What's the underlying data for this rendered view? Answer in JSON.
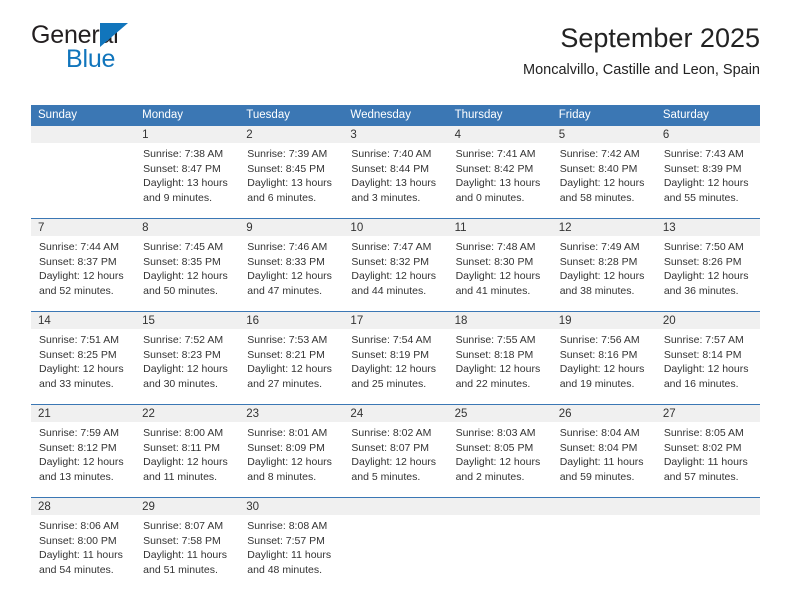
{
  "brand": {
    "name_part1": "General",
    "name_part2": "Blue",
    "triangle_color": "#1175bc",
    "text_color": "#231f20"
  },
  "header": {
    "title": "September 2025",
    "subtitle": "Moncalvillo, Castille and Leon, Spain"
  },
  "theme": {
    "header_blue": "#3b77b4",
    "daynum_band": "#f0f0f0",
    "text": "#333333"
  },
  "weekday_headers": [
    "Sunday",
    "Monday",
    "Tuesday",
    "Wednesday",
    "Thursday",
    "Friday",
    "Saturday"
  ],
  "weeks": [
    {
      "days": [
        {
          "num": "",
          "sunrise": "",
          "sunset": "",
          "daylight_1": "",
          "daylight_2": ""
        },
        {
          "num": "1",
          "sunrise": "Sunrise: 7:38 AM",
          "sunset": "Sunset: 8:47 PM",
          "daylight_1": "Daylight: 13 hours",
          "daylight_2": "and 9 minutes."
        },
        {
          "num": "2",
          "sunrise": "Sunrise: 7:39 AM",
          "sunset": "Sunset: 8:45 PM",
          "daylight_1": "Daylight: 13 hours",
          "daylight_2": "and 6 minutes."
        },
        {
          "num": "3",
          "sunrise": "Sunrise: 7:40 AM",
          "sunset": "Sunset: 8:44 PM",
          "daylight_1": "Daylight: 13 hours",
          "daylight_2": "and 3 minutes."
        },
        {
          "num": "4",
          "sunrise": "Sunrise: 7:41 AM",
          "sunset": "Sunset: 8:42 PM",
          "daylight_1": "Daylight: 13 hours",
          "daylight_2": "and 0 minutes."
        },
        {
          "num": "5",
          "sunrise": "Sunrise: 7:42 AM",
          "sunset": "Sunset: 8:40 PM",
          "daylight_1": "Daylight: 12 hours",
          "daylight_2": "and 58 minutes."
        },
        {
          "num": "6",
          "sunrise": "Sunrise: 7:43 AM",
          "sunset": "Sunset: 8:39 PM",
          "daylight_1": "Daylight: 12 hours",
          "daylight_2": "and 55 minutes."
        }
      ]
    },
    {
      "days": [
        {
          "num": "7",
          "sunrise": "Sunrise: 7:44 AM",
          "sunset": "Sunset: 8:37 PM",
          "daylight_1": "Daylight: 12 hours",
          "daylight_2": "and 52 minutes."
        },
        {
          "num": "8",
          "sunrise": "Sunrise: 7:45 AM",
          "sunset": "Sunset: 8:35 PM",
          "daylight_1": "Daylight: 12 hours",
          "daylight_2": "and 50 minutes."
        },
        {
          "num": "9",
          "sunrise": "Sunrise: 7:46 AM",
          "sunset": "Sunset: 8:33 PM",
          "daylight_1": "Daylight: 12 hours",
          "daylight_2": "and 47 minutes."
        },
        {
          "num": "10",
          "sunrise": "Sunrise: 7:47 AM",
          "sunset": "Sunset: 8:32 PM",
          "daylight_1": "Daylight: 12 hours",
          "daylight_2": "and 44 minutes."
        },
        {
          "num": "11",
          "sunrise": "Sunrise: 7:48 AM",
          "sunset": "Sunset: 8:30 PM",
          "daylight_1": "Daylight: 12 hours",
          "daylight_2": "and 41 minutes."
        },
        {
          "num": "12",
          "sunrise": "Sunrise: 7:49 AM",
          "sunset": "Sunset: 8:28 PM",
          "daylight_1": "Daylight: 12 hours",
          "daylight_2": "and 38 minutes."
        },
        {
          "num": "13",
          "sunrise": "Sunrise: 7:50 AM",
          "sunset": "Sunset: 8:26 PM",
          "daylight_1": "Daylight: 12 hours",
          "daylight_2": "and 36 minutes."
        }
      ]
    },
    {
      "days": [
        {
          "num": "14",
          "sunrise": "Sunrise: 7:51 AM",
          "sunset": "Sunset: 8:25 PM",
          "daylight_1": "Daylight: 12 hours",
          "daylight_2": "and 33 minutes."
        },
        {
          "num": "15",
          "sunrise": "Sunrise: 7:52 AM",
          "sunset": "Sunset: 8:23 PM",
          "daylight_1": "Daylight: 12 hours",
          "daylight_2": "and 30 minutes."
        },
        {
          "num": "16",
          "sunrise": "Sunrise: 7:53 AM",
          "sunset": "Sunset: 8:21 PM",
          "daylight_1": "Daylight: 12 hours",
          "daylight_2": "and 27 minutes."
        },
        {
          "num": "17",
          "sunrise": "Sunrise: 7:54 AM",
          "sunset": "Sunset: 8:19 PM",
          "daylight_1": "Daylight: 12 hours",
          "daylight_2": "and 25 minutes."
        },
        {
          "num": "18",
          "sunrise": "Sunrise: 7:55 AM",
          "sunset": "Sunset: 8:18 PM",
          "daylight_1": "Daylight: 12 hours",
          "daylight_2": "and 22 minutes."
        },
        {
          "num": "19",
          "sunrise": "Sunrise: 7:56 AM",
          "sunset": "Sunset: 8:16 PM",
          "daylight_1": "Daylight: 12 hours",
          "daylight_2": "and 19 minutes."
        },
        {
          "num": "20",
          "sunrise": "Sunrise: 7:57 AM",
          "sunset": "Sunset: 8:14 PM",
          "daylight_1": "Daylight: 12 hours",
          "daylight_2": "and 16 minutes."
        }
      ]
    },
    {
      "days": [
        {
          "num": "21",
          "sunrise": "Sunrise: 7:59 AM",
          "sunset": "Sunset: 8:12 PM",
          "daylight_1": "Daylight: 12 hours",
          "daylight_2": "and 13 minutes."
        },
        {
          "num": "22",
          "sunrise": "Sunrise: 8:00 AM",
          "sunset": "Sunset: 8:11 PM",
          "daylight_1": "Daylight: 12 hours",
          "daylight_2": "and 11 minutes."
        },
        {
          "num": "23",
          "sunrise": "Sunrise: 8:01 AM",
          "sunset": "Sunset: 8:09 PM",
          "daylight_1": "Daylight: 12 hours",
          "daylight_2": "and 8 minutes."
        },
        {
          "num": "24",
          "sunrise": "Sunrise: 8:02 AM",
          "sunset": "Sunset: 8:07 PM",
          "daylight_1": "Daylight: 12 hours",
          "daylight_2": "and 5 minutes."
        },
        {
          "num": "25",
          "sunrise": "Sunrise: 8:03 AM",
          "sunset": "Sunset: 8:05 PM",
          "daylight_1": "Daylight: 12 hours",
          "daylight_2": "and 2 minutes."
        },
        {
          "num": "26",
          "sunrise": "Sunrise: 8:04 AM",
          "sunset": "Sunset: 8:04 PM",
          "daylight_1": "Daylight: 11 hours",
          "daylight_2": "and 59 minutes."
        },
        {
          "num": "27",
          "sunrise": "Sunrise: 8:05 AM",
          "sunset": "Sunset: 8:02 PM",
          "daylight_1": "Daylight: 11 hours",
          "daylight_2": "and 57 minutes."
        }
      ]
    },
    {
      "days": [
        {
          "num": "28",
          "sunrise": "Sunrise: 8:06 AM",
          "sunset": "Sunset: 8:00 PM",
          "daylight_1": "Daylight: 11 hours",
          "daylight_2": "and 54 minutes."
        },
        {
          "num": "29",
          "sunrise": "Sunrise: 8:07 AM",
          "sunset": "Sunset: 7:58 PM",
          "daylight_1": "Daylight: 11 hours",
          "daylight_2": "and 51 minutes."
        },
        {
          "num": "30",
          "sunrise": "Sunrise: 8:08 AM",
          "sunset": "Sunset: 7:57 PM",
          "daylight_1": "Daylight: 11 hours",
          "daylight_2": "and 48 minutes."
        },
        {
          "num": "",
          "sunrise": "",
          "sunset": "",
          "daylight_1": "",
          "daylight_2": ""
        },
        {
          "num": "",
          "sunrise": "",
          "sunset": "",
          "daylight_1": "",
          "daylight_2": ""
        },
        {
          "num": "",
          "sunrise": "",
          "sunset": "",
          "daylight_1": "",
          "daylight_2": ""
        },
        {
          "num": "",
          "sunrise": "",
          "sunset": "",
          "daylight_1": "",
          "daylight_2": ""
        }
      ]
    }
  ]
}
